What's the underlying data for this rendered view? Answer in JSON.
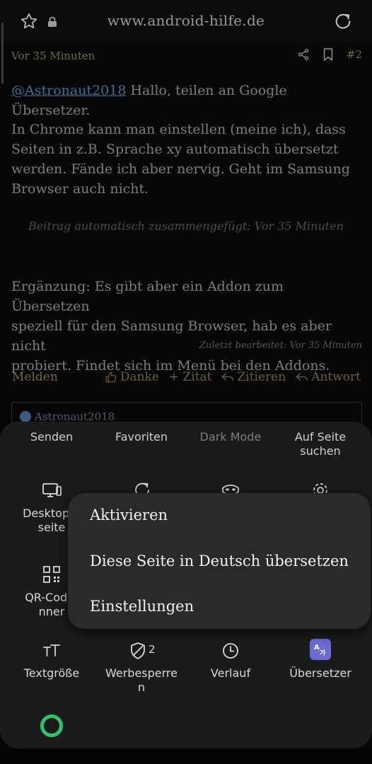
{
  "browser": {
    "url": "www.android-hilfe.de"
  },
  "post": {
    "time": "Vor 35 Minuten",
    "number": "#2",
    "mention": "@Astronaut2018",
    "line1_rest": " Hallo, teilen an Google Übersetzer.",
    "para2_lines": [
      "In Chrome kann man einstellen (meine ich), dass",
      "Seiten in z.B. Sprache xy automatisch übersetzt",
      "werden. Fände ich aber nervig. Geht im Samsung",
      "Browser auch nicht."
    ],
    "merged_note": "Beitrag automatisch zusammengefügt: Vor 35 Minuten",
    "para3_lines": [
      "Ergänzung: Es gibt aber ein Addon zum Übersetzen",
      "speziell für den Samsung Browser, hab es aber nicht",
      "probiert. Findet sich im Menü bei den Addons."
    ],
    "edited_note": "Zuletzt bearbeitet: Vor 35 Minuten",
    "report_label": "Melden",
    "thanks_label": "Danke",
    "quote_label": "+ Zitat",
    "cite_label": "Zitieren",
    "reply_label": "Antwort",
    "quoted_user": "Astronaut2018"
  },
  "menu": {
    "row0": [
      "Senden",
      "Favoriten",
      "Dark Mode",
      "Auf Seite suchen"
    ],
    "row1": [
      "Desktop-Ver seite",
      "",
      "",
      ""
    ],
    "desktop_line1": "Desktop-V",
    "desktop_line2": "seite",
    "qr_line1": "QR-Code-",
    "qr_line2": "nner",
    "row3": {
      "text_size": "Textgröße",
      "ad_block_line1": "Werbesperre",
      "ad_block_line2": "n",
      "ad_block_count": "2",
      "history": "Verlauf",
      "translator": "Übersetzer"
    },
    "auf_seite_line1": "Auf Seite",
    "auf_seite_line2": "suchen"
  },
  "popup": {
    "items": [
      "Aktivieren",
      "Diese Seite in Deutsch übersetzen",
      "Einstellungen"
    ]
  },
  "colors": {
    "accent_olive": "#6f6a3a",
    "link_blue": "#3f6f92",
    "translator_purple": "#6b6bd6",
    "green_ring": "#2bc46a"
  }
}
